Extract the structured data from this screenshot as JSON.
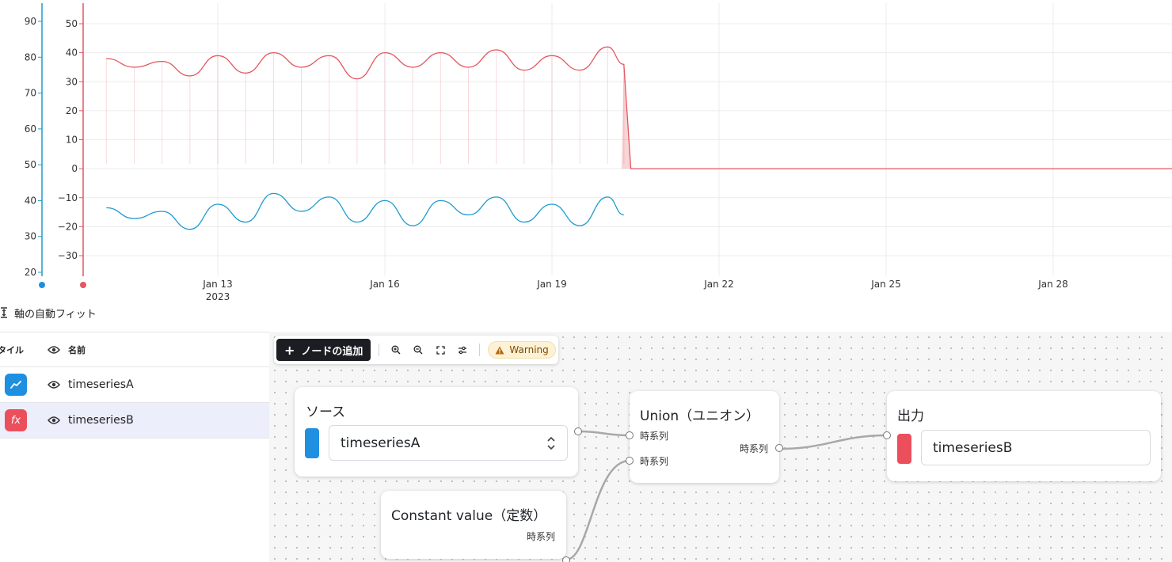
{
  "chart": {
    "left_axis_ticks": [
      "90",
      "80",
      "70",
      "60",
      "50",
      "40",
      "30",
      "20"
    ],
    "right_axis_ticks": [
      "50",
      "40",
      "30",
      "20",
      "10",
      "0",
      "−10",
      "−20",
      "−30"
    ],
    "x_ticks": [
      "Jan 13",
      "Jan 16",
      "Jan 19",
      "Jan 22",
      "Jan 25",
      "Jan 28"
    ],
    "x_year_label": "2023",
    "colors": {
      "series_a": "#1f9bd1",
      "series_b": "#e5565f",
      "grid": "#ececec"
    }
  },
  "chart_data": {
    "type": "line",
    "x_unit": "date",
    "xlim": [
      "2023-01-11",
      "2023-01-31"
    ],
    "series": [
      {
        "name": "timeseriesA",
        "axis": "left",
        "ylim": [
          19,
          95
        ],
        "x": [
          "2023-01-11",
          "2023-01-11 12:00",
          "2023-01-12",
          "2023-01-12 12:00",
          "2023-01-13",
          "2023-01-13 12:00",
          "2023-01-14",
          "2023-01-14 12:00",
          "2023-01-15",
          "2023-01-15 12:00",
          "2023-01-16",
          "2023-01-16 12:00",
          "2023-01-17",
          "2023-01-17 12:00",
          "2023-01-18",
          "2023-01-18 12:00",
          "2023-01-19",
          "2023-01-19 12:00",
          "2023-01-20",
          "2023-01-20 07:00"
        ],
        "values": [
          38,
          35,
          37,
          32,
          39,
          34,
          42,
          37,
          41,
          34,
          40,
          33,
          40,
          36,
          41,
          34,
          39,
          33,
          41,
          36
        ]
      },
      {
        "name": "timeseriesB",
        "axis": "right",
        "ylim": [
          -36,
          56
        ],
        "x": [
          "2023-01-11",
          "2023-01-11 12:00",
          "2023-01-12",
          "2023-01-12 12:00",
          "2023-01-13",
          "2023-01-13 12:00",
          "2023-01-14",
          "2023-01-14 12:00",
          "2023-01-15",
          "2023-01-15 12:00",
          "2023-01-16",
          "2023-01-16 12:00",
          "2023-01-17",
          "2023-01-17 12:00",
          "2023-01-18",
          "2023-01-18 12:00",
          "2023-01-19",
          "2023-01-19 12:00",
          "2023-01-20",
          "2023-01-20 07:00",
          "2023-01-20 10:00",
          "2023-01-31"
        ],
        "values": [
          38,
          35,
          37,
          32,
          39,
          33,
          40,
          35,
          39,
          31,
          40,
          35,
          40,
          35,
          41,
          34,
          39,
          34,
          42,
          36,
          0,
          0
        ]
      }
    ]
  },
  "autofit": {
    "label": "軸の自動フィット"
  },
  "series_table": {
    "header_style": "スタイル",
    "header_name": "名前",
    "rows": [
      {
        "name": "timeseriesA",
        "color": "#1f8fe0",
        "icon": "line-chart-icon"
      },
      {
        "name": "timeseriesB",
        "color": "#eb4f5c",
        "icon": "function-icon",
        "symbol": "fx"
      }
    ]
  },
  "toolbar": {
    "add_node": "ノードの追加",
    "warning": "Warning"
  },
  "nodes": {
    "source": {
      "title": "ソース",
      "value": "timeseriesA",
      "color": "#1f8fe0"
    },
    "constant": {
      "title": "Constant value（定数）",
      "output": "時系列"
    },
    "union": {
      "title": "Union（ユニオン）",
      "input1": "時系列",
      "input2": "時系列",
      "output": "時系列"
    },
    "output": {
      "title": "出力",
      "value": "timeseriesB",
      "color": "#eb4f5c"
    }
  }
}
